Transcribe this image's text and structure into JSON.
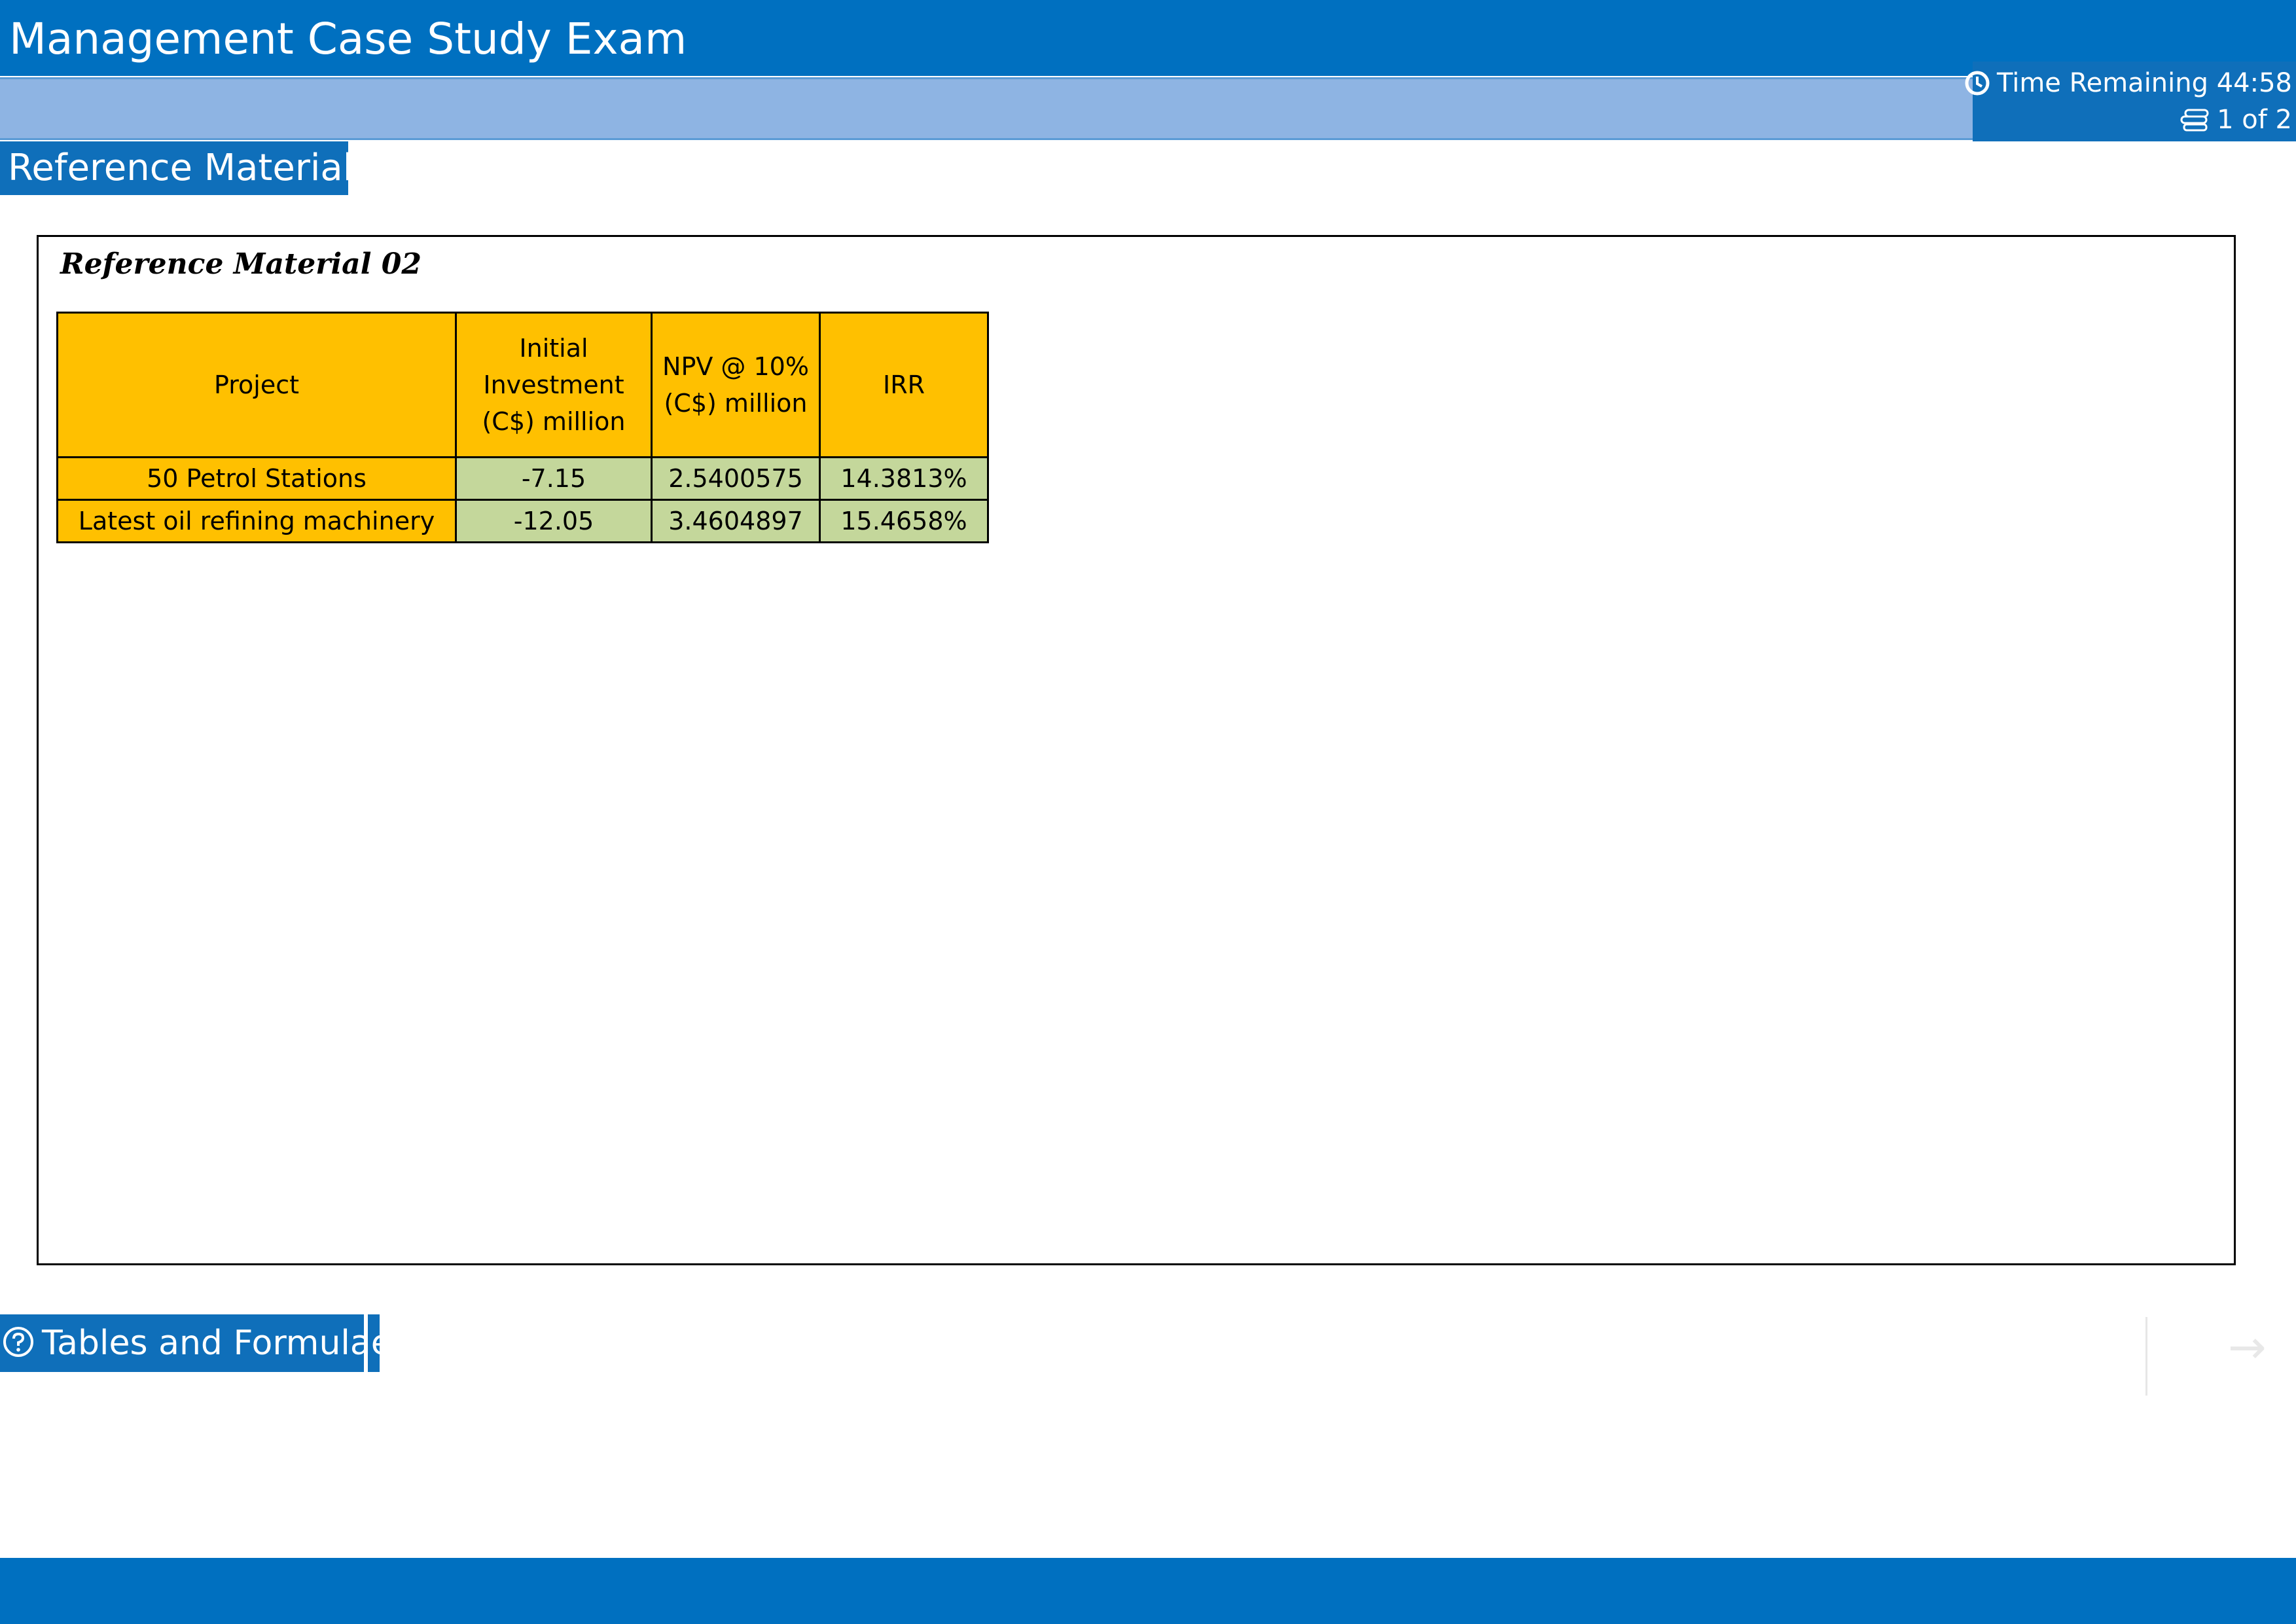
{
  "header": {
    "title": "Management Case Study Exam"
  },
  "status": {
    "time_label": "Time Remaining 44:58",
    "page_label": "1 of 2",
    "clock_icon": "clock-icon",
    "page_icon": "pages-icon"
  },
  "reference_tab": {
    "label": "Reference Material"
  },
  "panel": {
    "heading": "Reference Material 02",
    "table": {
      "headers": [
        "Project",
        "Initial Investment (C$) million",
        "NPV @ 10% (C$) million",
        "IRR"
      ],
      "rows": [
        [
          "50 Petrol Stations",
          "-7.15",
          "2.5400575",
          "14.3813%"
        ],
        [
          "Latest oil refining machinery",
          "-12.05",
          "3.4604897",
          "15.4658%"
        ]
      ]
    }
  },
  "footer": {
    "tables_button": "Tables and Formulae",
    "help_icon": "help-circle-icon",
    "next_icon": "next-arrow-icon"
  },
  "colors": {
    "brand_blue": "#0070c0",
    "header_yellow": "#ffc000",
    "cell_green": "#c4d79b",
    "subbar_blue": "#8eb4e3"
  }
}
